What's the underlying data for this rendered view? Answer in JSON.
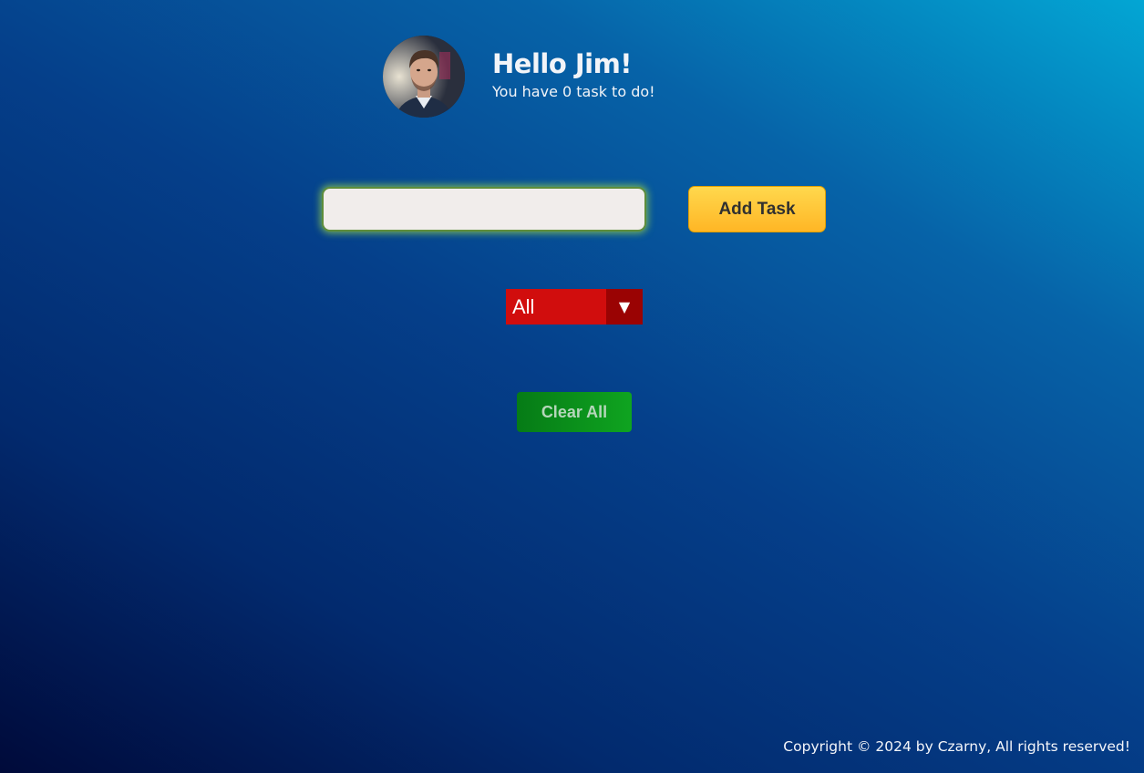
{
  "header": {
    "greeting": "Hello Jim!",
    "task_count_text": "You have 0 task to do!",
    "avatar": "profile-photo"
  },
  "task_input": {
    "value": "",
    "placeholder": ""
  },
  "add_button": {
    "label": "Add Task"
  },
  "filter": {
    "selected": "All",
    "arrow": "▼"
  },
  "clear_button": {
    "label": "Clear All"
  },
  "footer": {
    "copyright": "Copyright © 2024 by Czarny, All rights reserved!"
  },
  "colors": {
    "add_button": "#ffc93a",
    "filter": "#d10d0d",
    "clear_button": "#0a9019",
    "input_glow": "#92ce4e"
  }
}
